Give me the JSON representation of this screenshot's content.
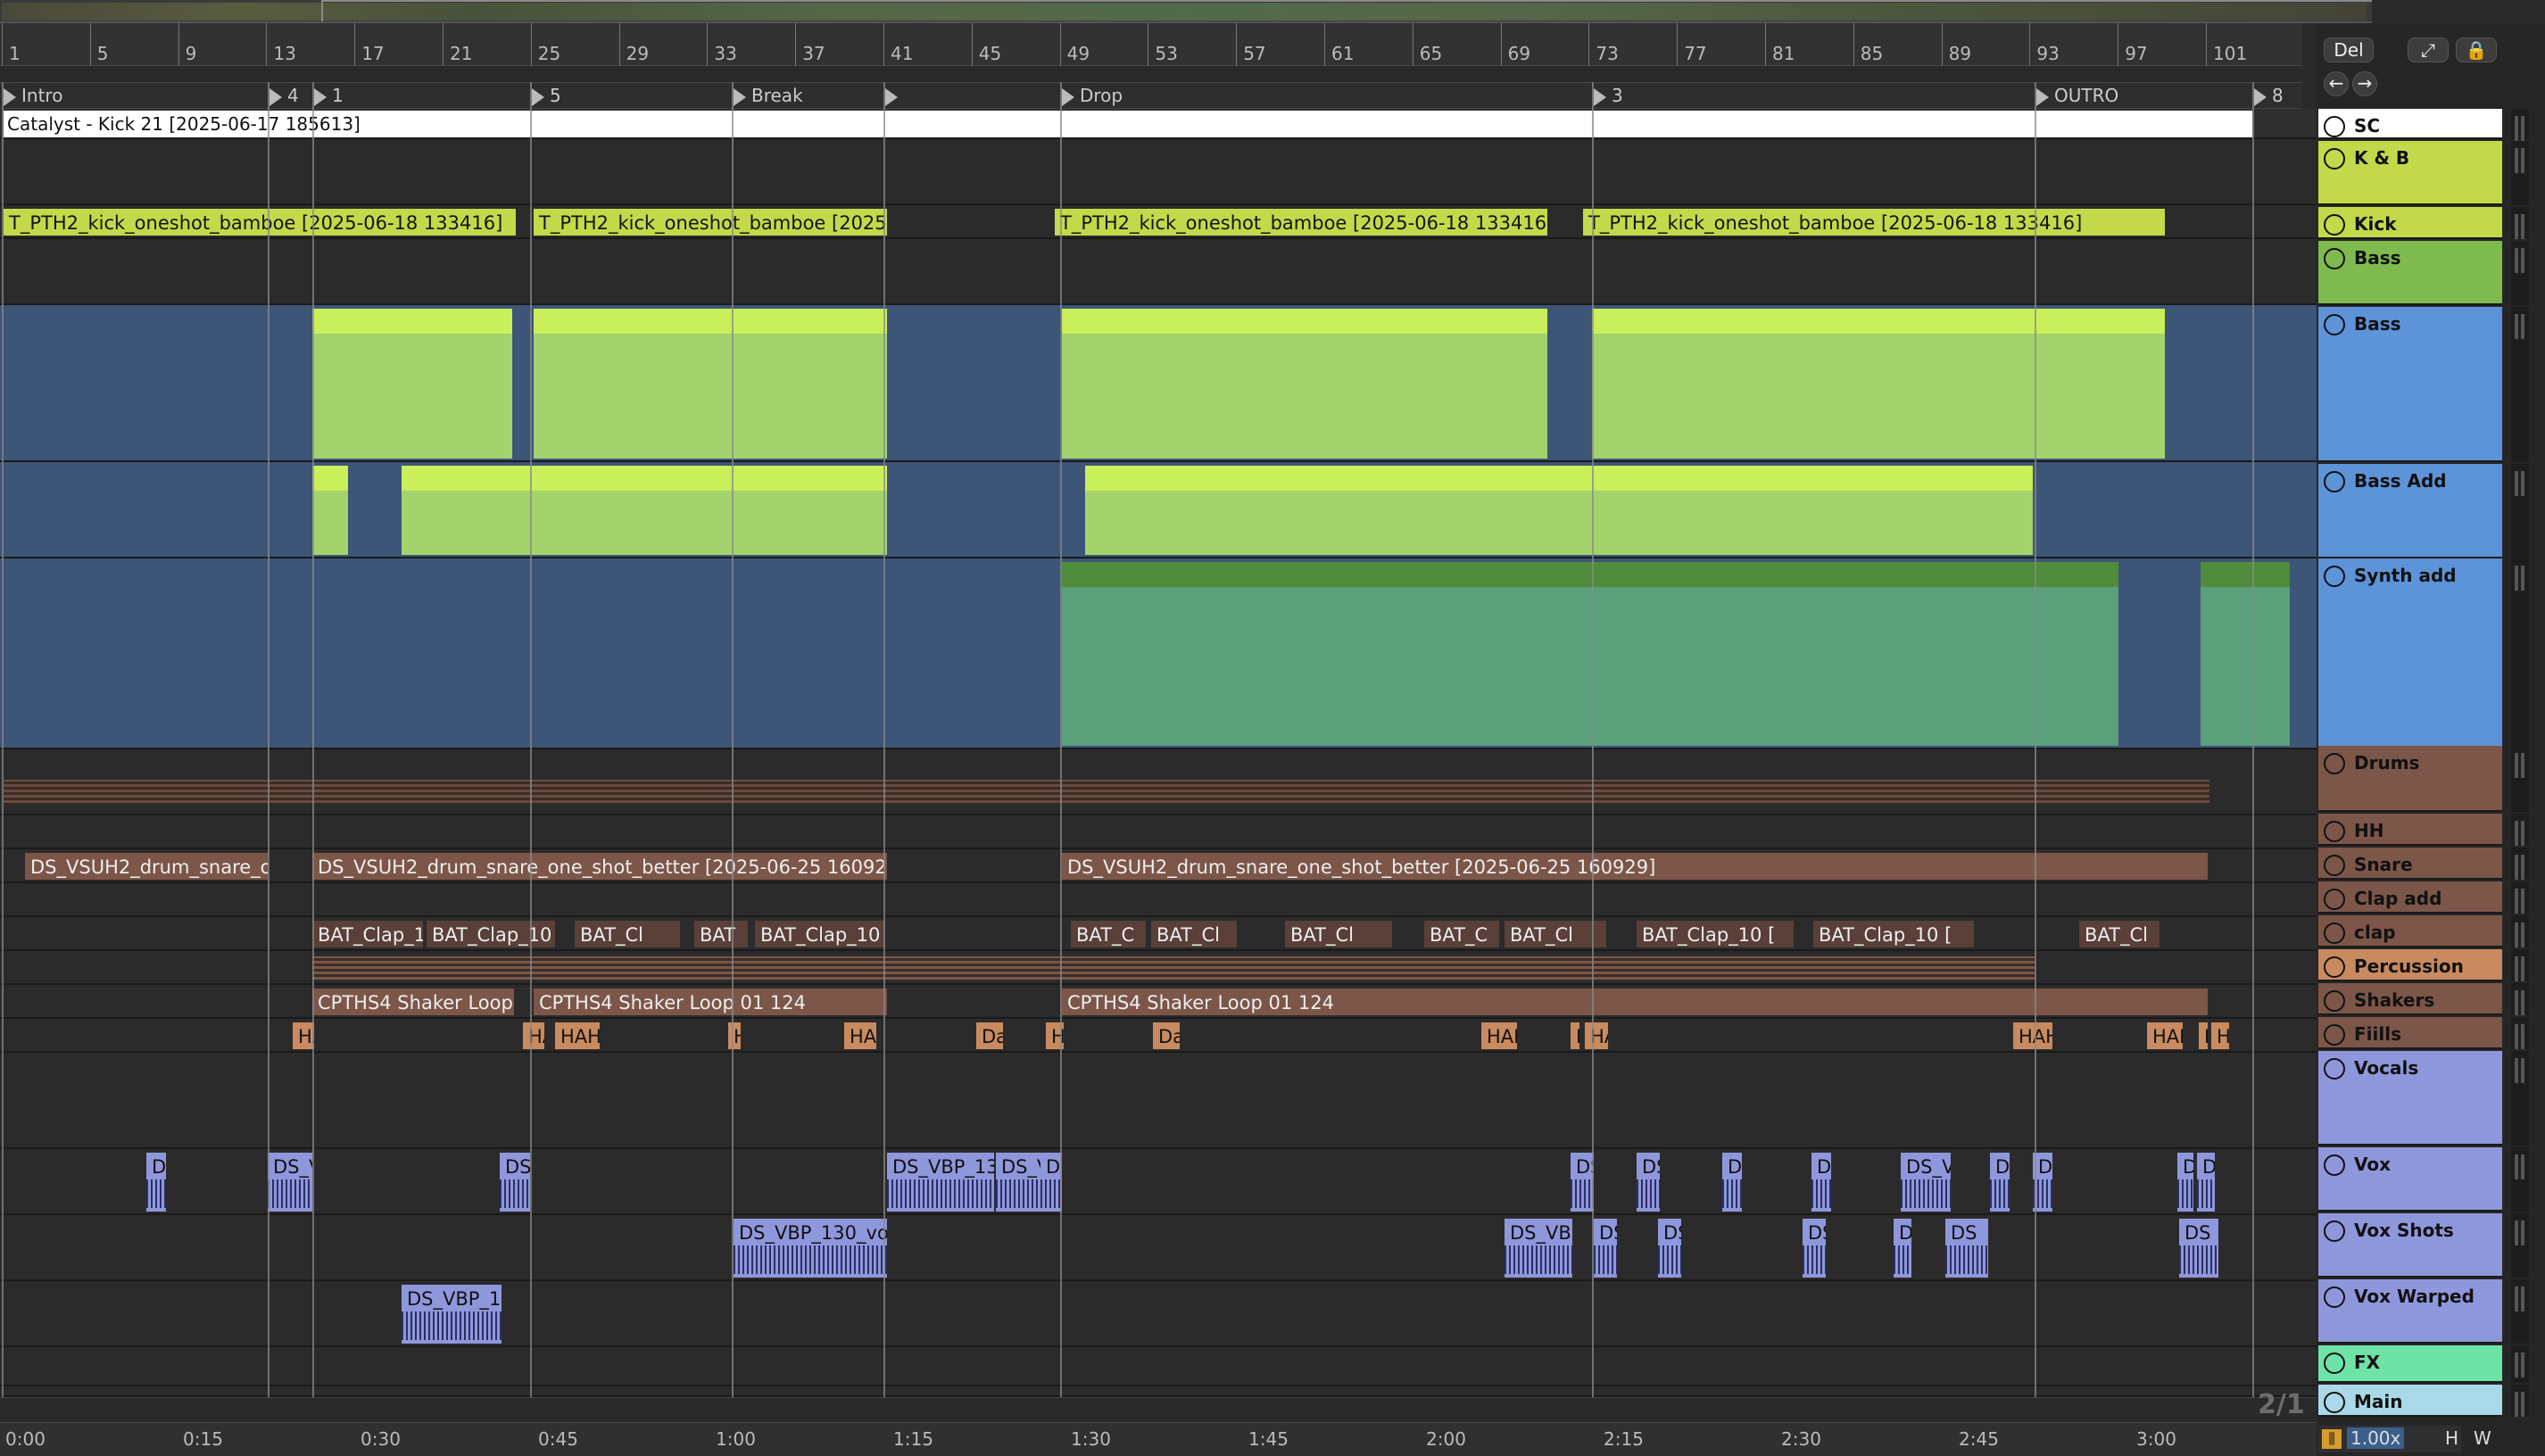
{
  "ruler": {
    "bars": [
      "1",
      "5",
      "9",
      "13",
      "17",
      "21",
      "25",
      "29",
      "33",
      "37",
      "41",
      "45",
      "49",
      "53",
      "57",
      "61",
      "65",
      "69",
      "73",
      "77",
      "81",
      "85",
      "89",
      "93",
      "97",
      "101"
    ]
  },
  "locators": [
    {
      "label": "Intro"
    },
    {
      "label": "4"
    },
    {
      "label": "1"
    },
    {
      "label": "5"
    },
    {
      "label": "Break"
    },
    {
      "label": ""
    },
    {
      "label": "Drop"
    },
    {
      "label": "3"
    },
    {
      "label": "OUTRO"
    },
    {
      "label": "8"
    }
  ],
  "timebar": {
    "labels": [
      "0:00",
      "0:15",
      "0:30",
      "0:45",
      "1:00",
      "1:15",
      "1:30",
      "1:45",
      "2:00",
      "2:15",
      "2:30",
      "2:45",
      "3:00"
    ]
  },
  "top_buttons": {
    "del": "Del"
  },
  "zoom_value": "1.00x",
  "h_label": "H",
  "w_label": "W",
  "page_indicator": "2/1",
  "colors": {
    "lime": "#c4d94a",
    "lime_light": "#d6f561",
    "green": "#a4d36d",
    "green_light": "#c9ef5a",
    "teal": "#5aa07b",
    "blue": "#415a80",
    "brown": "#7c5648",
    "orange": "#c98a5f",
    "purple": "#8f97dc",
    "mint": "#6ee3a8"
  },
  "lanes": {
    "sc": {
      "clips": [
        {
          "label": "Catalyst - Kick 21 [2025-06-17 185613]"
        }
      ]
    },
    "kick": {
      "clips": [
        {
          "label": "T_PTH2_kick_oneshot_bamboe [2025-06-18 133416]"
        },
        {
          "label": "T_PTH2_kick_oneshot_bamboe [2025-0"
        },
        {
          "label": "T_PTH2_kick_oneshot_bamboe [2025-06-18 133416]"
        },
        {
          "label": "T_PTH2_kick_oneshot_bamboe [2025-06-18 133416]"
        }
      ]
    },
    "snare": {
      "clips": [
        {
          "label": "DS_VSUH2_drum_snare_on"
        },
        {
          "label": "DS_VSUH2_drum_snare_one_shot_better [2025-06-25 160929]"
        },
        {
          "label": "DS_VSUH2_drum_snare_one_shot_better [2025-06-25 160929]"
        }
      ]
    },
    "clap": {
      "clips": [
        {
          "label": "BAT_Clap_1("
        },
        {
          "label": "BAT_Clap_10 ["
        },
        {
          "label": "BAT_Cl"
        },
        {
          "label": "BAT"
        },
        {
          "label": "BAT_Clap_10 ["
        },
        {
          "label": "BAT_C"
        },
        {
          "label": "BAT_Cl"
        },
        {
          "label": "BAT_Cl"
        },
        {
          "label": "BAT_C"
        },
        {
          "label": "BAT_Cl"
        },
        {
          "label": "BAT_Clap_10 ["
        },
        {
          "label": "BAT_Clap_10 ["
        },
        {
          "label": "BAT_Cl"
        }
      ]
    },
    "shakers": {
      "clips": [
        {
          "label": "CPTHS4 Shaker Loop 0"
        },
        {
          "label": "CPTHS4 Shaker Loop 01 124"
        },
        {
          "label": "CPTHS4 Shaker Loop 01 124"
        }
      ]
    },
    "fills": {
      "clips": [
        {
          "label": "HA"
        },
        {
          "label": "HA"
        },
        {
          "label": "HAH"
        },
        {
          "label": "H"
        },
        {
          "label": "HA"
        },
        {
          "label": "Da"
        },
        {
          "label": "HA"
        },
        {
          "label": "Da"
        },
        {
          "label": "HAH"
        },
        {
          "label": "H"
        },
        {
          "label": "HA"
        },
        {
          "label": "HAH"
        },
        {
          "label": "HAH"
        },
        {
          "label": "H"
        },
        {
          "label": "H"
        }
      ]
    },
    "vox": {
      "clips": [
        {
          "label": "D"
        },
        {
          "label": "DS_V"
        },
        {
          "label": "DS"
        },
        {
          "label": "DS_VBP_130"
        },
        {
          "label": "DS_VI"
        },
        {
          "label": "D"
        },
        {
          "label": "DS"
        },
        {
          "label": "DS"
        },
        {
          "label": "D"
        },
        {
          "label": "D"
        },
        {
          "label": "DS_V"
        },
        {
          "label": "D"
        },
        {
          "label": "D"
        },
        {
          "label": "D"
        },
        {
          "label": "D"
        }
      ]
    },
    "voxshots": {
      "clips": [
        {
          "label": "DS_VBP_130_voc"
        },
        {
          "label": "DS_VBI"
        },
        {
          "label": "DS"
        },
        {
          "label": "DS"
        },
        {
          "label": "DS"
        },
        {
          "label": "D"
        },
        {
          "label": "DS"
        },
        {
          "label": "DS"
        }
      ]
    },
    "voxwarped": {
      "clips": [
        {
          "label": "DS_VBP_13"
        }
      ]
    }
  },
  "tracks": [
    {
      "name": "SC",
      "icon": "play-icon",
      "color": "#ffffff"
    },
    {
      "name": "K & B",
      "icon": "group-icon",
      "color": "#c4d94a"
    },
    {
      "name": "Kick",
      "icon": "play-icon",
      "color": "#c4d94a"
    },
    {
      "name": "Bass",
      "icon": "group-icon",
      "color": "#7fba4e"
    },
    {
      "name": "Bass",
      "icon": "chevron-down-icon",
      "color": "#5d93d8"
    },
    {
      "name": "Bass Add",
      "icon": "chevron-down-icon",
      "color": "#5d93d8"
    },
    {
      "name": "Synth add",
      "icon": "chevron-down-icon",
      "color": "#5d93d8"
    },
    {
      "name": "Drums",
      "icon": "group-icon",
      "color": "#7c5648"
    },
    {
      "name": "HH",
      "icon": "group-icon",
      "color": "#7c5648"
    },
    {
      "name": "Snare",
      "icon": "play-icon",
      "color": "#7c5648"
    },
    {
      "name": "Clap add",
      "icon": "play-icon",
      "color": "#7c5648"
    },
    {
      "name": "clap",
      "icon": "group-icon",
      "color": "#7c5648"
    },
    {
      "name": "Percussion",
      "icon": "group-icon",
      "color": "#c98a5f"
    },
    {
      "name": "Shakers",
      "icon": "play-icon",
      "color": "#7c5648"
    },
    {
      "name": "Fiills",
      "icon": "play-icon",
      "color": "#7c5648"
    },
    {
      "name": "Vocals",
      "icon": "group-icon",
      "color": "#8f97dc"
    },
    {
      "name": "Vox",
      "icon": "chevron-down-icon",
      "color": "#8f97dc"
    },
    {
      "name": "Vox Shots",
      "icon": "chevron-down-icon",
      "color": "#8f97dc"
    },
    {
      "name": "Vox Warped",
      "icon": "chevron-down-icon",
      "color": "#8f97dc"
    },
    {
      "name": "FX",
      "icon": "group-icon",
      "color": "#6ee3a8"
    },
    {
      "name": "Main",
      "icon": "play-icon",
      "color": "#a9d8e8"
    }
  ]
}
